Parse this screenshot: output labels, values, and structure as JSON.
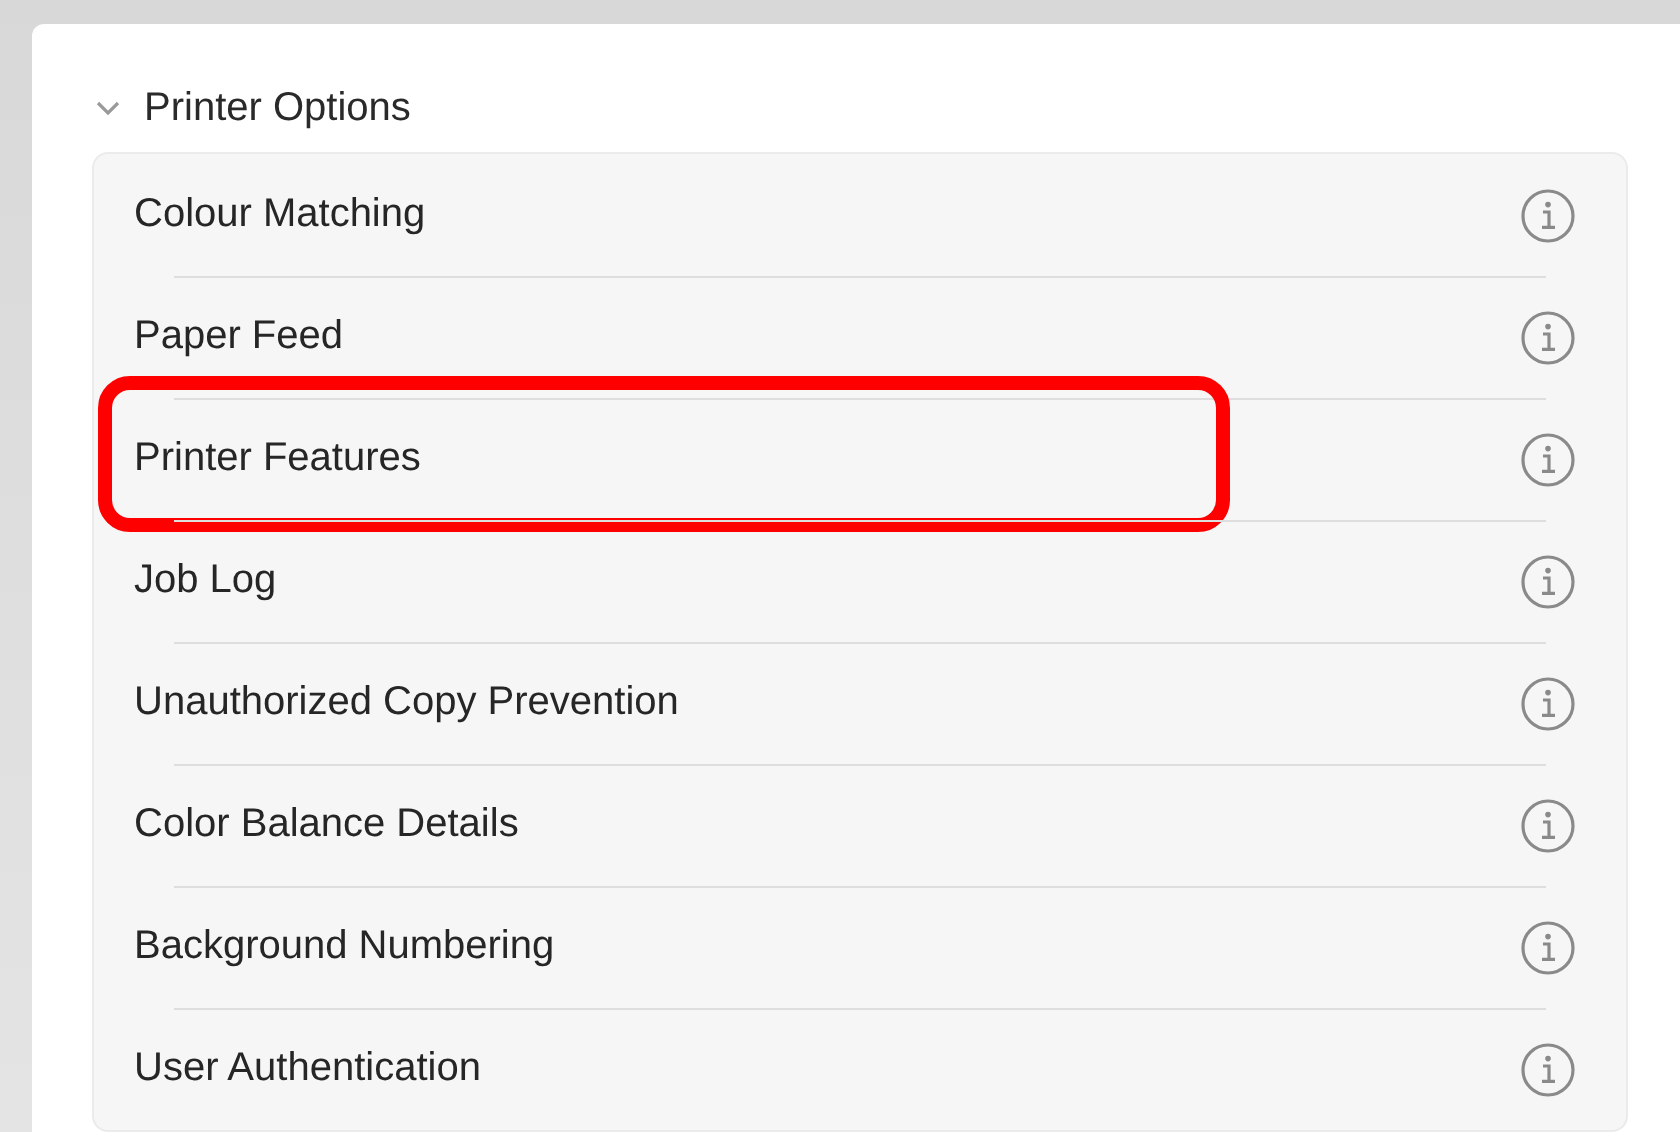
{
  "section": {
    "title": "Printer Options",
    "expanded": true,
    "items": [
      {
        "label": "Colour Matching",
        "highlighted": false
      },
      {
        "label": "Paper Feed",
        "highlighted": false
      },
      {
        "label": "Printer Features",
        "highlighted": true
      },
      {
        "label": "Job Log",
        "highlighted": false
      },
      {
        "label": "Unauthorized Copy Prevention",
        "highlighted": false
      },
      {
        "label": "Color Balance Details",
        "highlighted": false
      },
      {
        "label": "Background Numbering",
        "highlighted": false
      },
      {
        "label": "User Authentication",
        "highlighted": false
      }
    ]
  }
}
